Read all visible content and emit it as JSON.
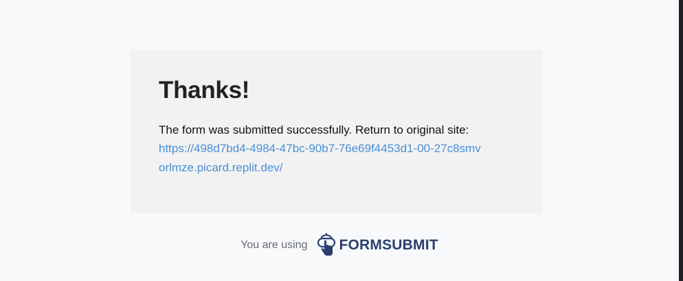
{
  "card": {
    "title": "Thanks!",
    "message": "The form was submitted successfully. Return to original site:",
    "link_text": "https://498d7bd4-4984-47bc-90b7-76e69f4453d1-00-27c8smvorlmze.picard.replit.dev/"
  },
  "footer": {
    "prefix": "You are using",
    "brand_name": "FORMSUBMIT",
    "brand_icon": "hand-pointer-icon"
  },
  "colors": {
    "page_background": "#f8f9fb",
    "card_background": "#f2f2f2",
    "link": "#4a8fd6",
    "brand": "#2a3f6e"
  }
}
